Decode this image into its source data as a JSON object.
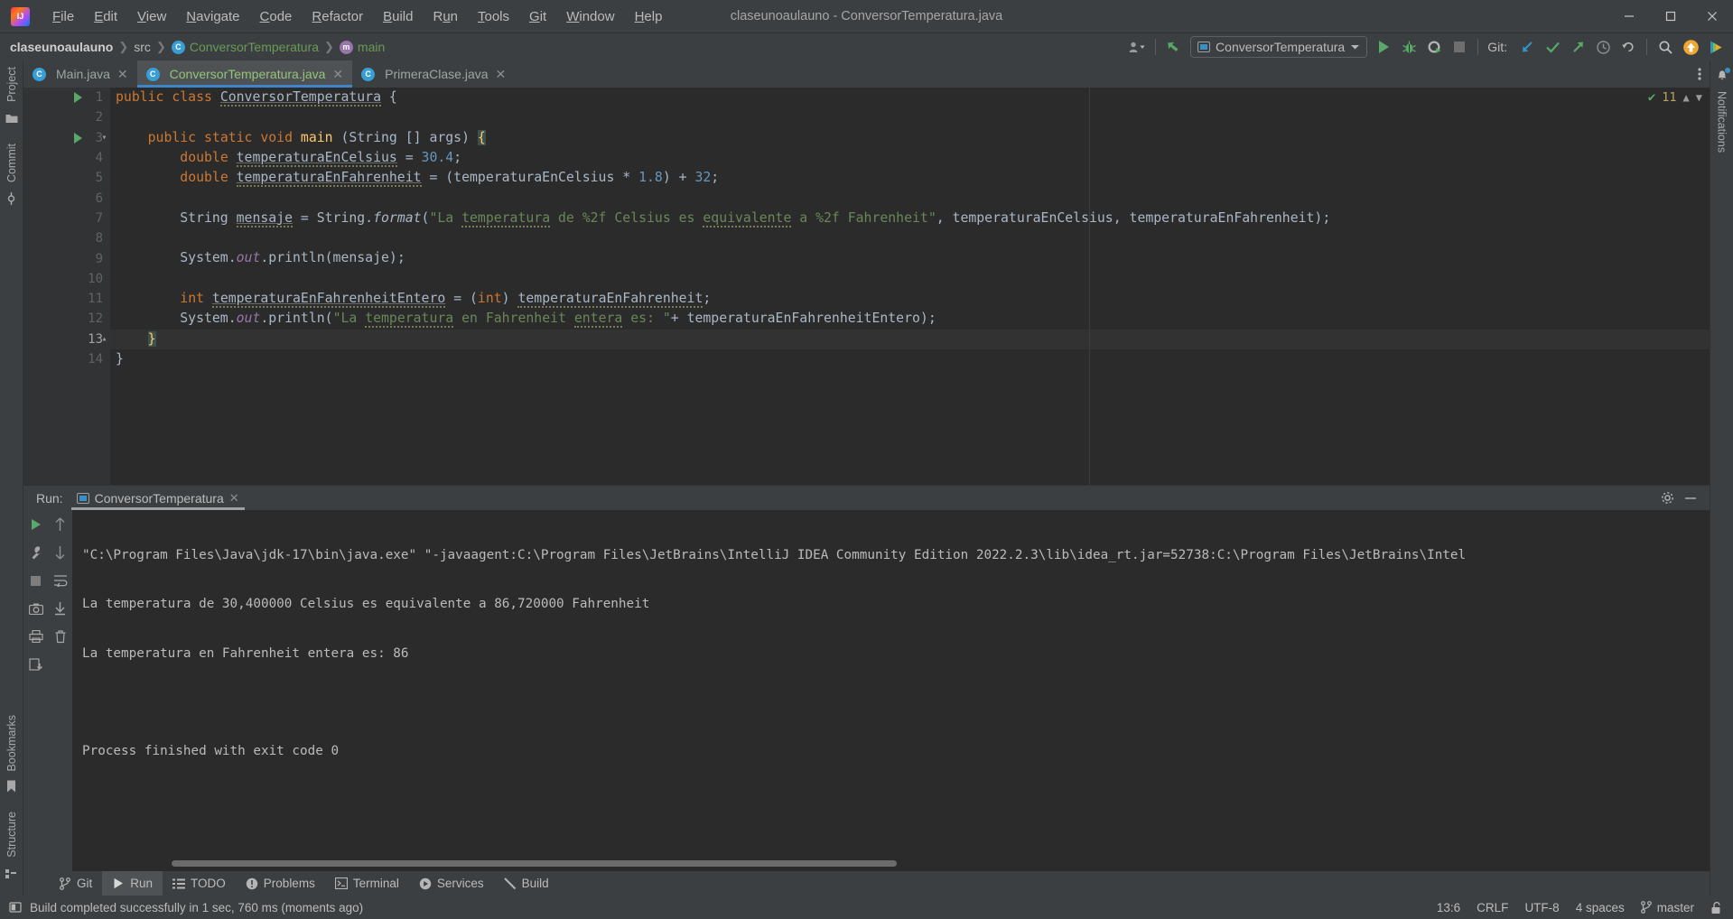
{
  "window": {
    "title": "claseunoaulauno - ConversorTemperatura.java",
    "logo": "intellij-idea-logo",
    "controls": {
      "minimize": "─",
      "maximize": "❐",
      "close": "✕"
    }
  },
  "menubar": [
    {
      "label": "File",
      "mnemonic": "F"
    },
    {
      "label": "Edit",
      "mnemonic": "E"
    },
    {
      "label": "View",
      "mnemonic": "V"
    },
    {
      "label": "Navigate",
      "mnemonic": "N"
    },
    {
      "label": "Code",
      "mnemonic": "C"
    },
    {
      "label": "Refactor",
      "mnemonic": "R"
    },
    {
      "label": "Build",
      "mnemonic": "B"
    },
    {
      "label": "Run",
      "mnemonic": "u"
    },
    {
      "label": "Tools",
      "mnemonic": "T"
    },
    {
      "label": "Git",
      "mnemonic": "G"
    },
    {
      "label": "Window",
      "mnemonic": "W"
    },
    {
      "label": "Help",
      "mnemonic": "H"
    }
  ],
  "breadcrumb": [
    {
      "label": "claseunoaulauno",
      "icon": "project-icon"
    },
    {
      "label": "src",
      "icon": "folder-icon"
    },
    {
      "label": "ConversorTemperatura",
      "icon": "class-icon"
    },
    {
      "label": "main",
      "icon": "method-icon"
    }
  ],
  "toolbar": {
    "run_configuration": "ConversorTemperatura",
    "git_label": "Git:",
    "actions": [
      "user-avatar-dropdown",
      "updates-arrow-icon",
      "run-button",
      "debug-button",
      "run-with-coverage-button",
      "stop-button",
      "git-update-icon",
      "git-commit-icon",
      "git-push-icon",
      "git-history-icon",
      "git-rollback-icon",
      "search-everywhere-icon",
      "ide-update-icon",
      "ai-assistant-icon"
    ]
  },
  "left_rail": [
    {
      "label": "Project",
      "icon": "project-folder-icon"
    },
    {
      "label": "Commit",
      "icon": "commit-icon"
    },
    {
      "label": "Bookmarks",
      "icon": "bookmark-icon"
    },
    {
      "label": "Structure",
      "icon": "structure-icon"
    }
  ],
  "right_rail": [
    {
      "label": "Notifications",
      "icon": "bell-icon"
    }
  ],
  "editor_tabs": [
    {
      "label": "Main.java",
      "icon": "java-class-icon",
      "active": false
    },
    {
      "label": "ConversorTemperatura.java",
      "icon": "java-class-icon",
      "active": true
    },
    {
      "label": "PrimeraClase.java",
      "icon": "java-class-icon",
      "active": false
    }
  ],
  "editor": {
    "line_numbers": [
      "1",
      "2",
      "3",
      "4",
      "5",
      "6",
      "7",
      "8",
      "9",
      "10",
      "11",
      "12",
      "13",
      "14"
    ],
    "current_line": 13,
    "run_markers": [
      1,
      3
    ],
    "inspection_ok": "✔",
    "inspection_count": "11",
    "lines": [
      "public class ConversorTemperatura {",
      "",
      "    public static void main (String [] args) {",
      "        double temperaturaEnCelsius = 30.4;",
      "        double temperaturaEnFahrenheit = (temperaturaEnCelsius * 1.8) + 32;",
      "",
      "        String mensaje = String.format(\"La temperatura de %2f Celsius es equivalente a %2f Fahrenheit\", temperaturaEnCelsius, temperaturaEnFahrenheit);",
      "",
      "        System.out.println(mensaje);",
      "",
      "        int temperaturaEnFahrenheitEntero = (int) temperaturaEnFahrenheit;",
      "        System.out.println(\"La temperatura en Fahrenheit entera es: \"+ temperaturaEnFahrenheitEntero);",
      "    }",
      "}"
    ]
  },
  "run_window": {
    "label": "Run:",
    "tab": "ConversorTemperatura",
    "tab_icon": "run-config-icon",
    "header_actions": [
      "settings-gear-icon",
      "minimize-icon"
    ],
    "side_actions": [
      "rerun-icon",
      "wrench-icon",
      "stop-icon",
      "camera-icon",
      "print-icon",
      "export-icon",
      "up-arrow-icon",
      "down-arrow-icon",
      "soft-wrap-icon",
      "scroll-to-end-icon",
      "trash-icon"
    ],
    "console_lines": [
      "\"C:\\Program Files\\Java\\jdk-17\\bin\\java.exe\" \"-javaagent:C:\\Program Files\\JetBrains\\IntelliJ IDEA Community Edition 2022.2.3\\lib\\idea_rt.jar=52738:C:\\Program Files\\JetBrains\\Intel",
      "La temperatura de 30,400000 Celsius es equivalente a 86,720000 Fahrenheit",
      "La temperatura en Fahrenheit entera es: 86",
      "",
      "Process finished with exit code 0"
    ]
  },
  "bottom_tabs": [
    {
      "label": "Git",
      "icon": "git-branch-icon",
      "active": false
    },
    {
      "label": "Run",
      "icon": "run-play-icon",
      "active": true
    },
    {
      "label": "TODO",
      "icon": "todo-list-icon",
      "active": false
    },
    {
      "label": "Problems",
      "icon": "problems-icon",
      "active": false
    },
    {
      "label": "Terminal",
      "icon": "terminal-icon",
      "active": false
    },
    {
      "label": "Services",
      "icon": "services-icon",
      "active": false
    },
    {
      "label": "Build",
      "icon": "build-hammer-icon",
      "active": false
    }
  ],
  "status_bar": {
    "message": "Build completed successfully in 1 sec, 760 ms (moments ago)",
    "message_icon": "build-status-icon",
    "caret_position": "13:6",
    "line_separator": "CRLF",
    "encoding": "UTF-8",
    "indent": "4 spaces",
    "branch": "master",
    "branch_icon": "git-branch-icon",
    "lock_icon": "unlocked-icon"
  },
  "colors": {
    "accent_blue": "#3d86c9",
    "green": "#59a869",
    "keyword": "#cc7832",
    "string": "#6a8759",
    "number": "#6897bb",
    "editor_bg": "#2b2b2b",
    "chrome_bg": "#3c3f41"
  }
}
